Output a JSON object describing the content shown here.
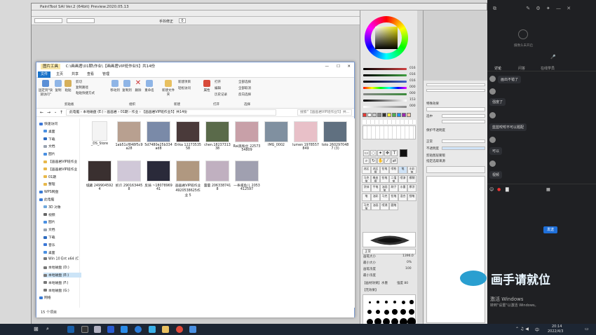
{
  "sai": {
    "title": "PaintTool SAI Ver.2 (64bit) Preview.2020.05.13",
    "menus": [
      "",
      "",
      "",
      "",
      "",
      "",
      "",
      "",
      ""
    ],
    "toolbar_zoom": "手抖修正",
    "toolbar_value": "0",
    "sliders": [
      {
        "value": "016",
        "color": "#d04040"
      },
      {
        "value": "016",
        "color": "#40a040"
      },
      {
        "value": "016",
        "color": "#4060d0"
      },
      {
        "value": "000",
        "color": "#c04040"
      },
      {
        "value": "000",
        "color": "#3a8a3a"
      },
      {
        "value": "153",
        "color": "#444444"
      },
      {
        "value": "000",
        "color": "#888888"
      }
    ],
    "layer_panel": {
      "section1": "特殊效果",
      "section2_a": "选中",
      "opacity_label": "不透明度",
      "opacity_value": "100%",
      "blend_label": "正常",
      "protect_label": "保护不透明度",
      "clip_label": "剪贴图层蒙版",
      "ref_label": "指定选取来源",
      "layer_name": "图层1",
      "layer_value": "100%",
      "status": "磁盘使用量",
      "status_value": "29%"
    },
    "brush_panel": {
      "brush_size_label": "画笔大小",
      "brush_size_value": "1396.0",
      "min_size_label": "最小大小",
      "min_size_value": "0%",
      "density_label": "画笔浓度",
      "density_value": "100",
      "min_density_label": "最小浓度",
      "texture_label": "【画材效果】水墨",
      "texture_value": "强度 80",
      "shape_label": "【无效果】",
      "blend_mode": "正常",
      "memory_label": "内存使用量",
      "memory_value": "23% (29%)"
    },
    "brushes": [
      "选区",
      "选区擦",
      "铅笔",
      "喷枪",
      "笔",
      "水彩笔",
      "马克笔",
      "橡皮擦",
      "铅笔",
      "二值笔",
      "喷漆",
      "模糊",
      "涂抹",
      "平笔",
      "油画笔",
      "刷子",
      "水墨",
      "厚涂",
      "笔",
      "油彩",
      "马克",
      "铅笔",
      "混合",
      "细笔",
      "马克笔",
      "油画",
      "喷溅",
      "圆笔"
    ]
  },
  "explorer": {
    "title": "C:\\画画君\\01期\\作业\\【画画君VIP班作业5】共14份",
    "tab_active": "图片工具",
    "tabs": [
      "文件",
      "主页",
      "共享",
      "查看",
      "管理"
    ],
    "ribbon": {
      "pin": "固定到\"快速访问\"",
      "copy": "复制",
      "paste": "粘贴",
      "cut": "剪切",
      "copy_path": "复制路径",
      "paste_shortcut": "粘贴快捷方式",
      "group_clipboard": "剪贴板",
      "move_to": "移动到",
      "copy_to": "复制到",
      "delete": "删除",
      "rename": "重命名",
      "group_organize": "组织",
      "new_folder": "新建文件夹",
      "new_item": "新建项目",
      "easy_access": "轻松访问",
      "group_new": "新建",
      "properties": "属性",
      "open": "打开",
      "edit": "编辑",
      "history": "历史记录",
      "group_open": "打开",
      "select_all": "全部选择",
      "select_none": "全部取消",
      "invert": "反向选择",
      "group_select": "选择"
    },
    "breadcrumb": "此电脑 › 本地磁盘 (E:) › 画画君 › 01期 › 作业 › 【画画君VIP班作业5】共14份",
    "search_placeholder": "搜索\"【画画君VIP班作业5】共...",
    "sidebar": [
      {
        "label": "快速访问",
        "color": "#3c78d8"
      },
      {
        "label": "桌面",
        "color": "#4a90e2"
      },
      {
        "label": "下载",
        "color": "#2d6cc0"
      },
      {
        "label": "文档",
        "color": "#9aa4b1"
      },
      {
        "label": "图片",
        "color": "#4a90e2"
      },
      {
        "label": "【画画君VIP班作业",
        "color": "#e8b84a"
      },
      {
        "label": "【画画君VIP班作业",
        "color": "#e8b84a"
      },
      {
        "label": "01期",
        "color": "#e8b84a"
      },
      {
        "label": "整理",
        "color": "#e8b84a"
      },
      {
        "label": "WPS网盘",
        "color": "#3a7bd5"
      },
      {
        "label": "此电脑",
        "color": "#3a7bd5"
      },
      {
        "label": "3D 对象",
        "color": "#6fa8dc"
      },
      {
        "label": "视频",
        "color": "#666666"
      },
      {
        "label": "图片",
        "color": "#4a90e2"
      },
      {
        "label": "文档",
        "color": "#9aa4b1"
      },
      {
        "label": "下载",
        "color": "#2d6cc0"
      },
      {
        "label": "音乐",
        "color": "#3c78d8"
      },
      {
        "label": "桌面",
        "color": "#4a90e2"
      },
      {
        "label": "Win 10 Ent x64 (C",
        "color": "#777777"
      },
      {
        "label": "本地磁盘 (D:)",
        "color": "#777777"
      },
      {
        "label": "本地磁盘 (E:)",
        "color": "#777777"
      },
      {
        "label": "本地磁盘 (F:)",
        "color": "#777777"
      },
      {
        "label": "本地磁盘 (G:)",
        "color": "#777777"
      },
      {
        "label": "网络",
        "color": "#3a7bd5"
      }
    ],
    "files": [
      {
        "name": "_DS_Store",
        "color": "#f4f4f4"
      },
      {
        "name": "1ab51cf848f5c9a28",
        "color": "#b8a090"
      },
      {
        "name": "5d7480e25b334ad8",
        "color": "#7a8aa8"
      },
      {
        "name": "Erika 1227353558",
        "color": "#4a3a3a"
      },
      {
        "name": "chen.1823731338",
        "color": "#5a6a4a"
      },
      {
        "name": "Rai黑粉丝 2257354809",
        "color": "#c8a0a8"
      },
      {
        "name": "IMG_0002",
        "color": "#8090a0"
      },
      {
        "name": "lumen 1978557849",
        "color": "#e8c0c8"
      },
      {
        "name": "toto 2602970487 (3)",
        "color": "#607080"
      },
      {
        "name": "城藏 2499045924",
        "color": "#3a3030"
      },
      {
        "name": "抓爪 2901634458",
        "color": "#d0c8d8"
      },
      {
        "name": "反骑 ~1807896941",
        "color": "#2a2a3a"
      },
      {
        "name": "画画君VIP班作业 4920538625作业 5",
        "color": "#b09880"
      },
      {
        "name": "蕾蕾 2063387418",
        "color": "#c0b0c0"
      },
      {
        "name": "一条咸鱼儿 2053412597",
        "color": "#a0a0b0"
      }
    ],
    "status": "15 个项目"
  },
  "chat": {
    "cam_label": "摄像头未开启",
    "tabs": [
      "讨论",
      "问答",
      "在线学员"
    ],
    "messages": [
      "画出不错了",
      "强度了",
      "稍有特殊",
      "蓝蓝咬咬不可以题配",
      "可以",
      "视频"
    ],
    "send": "发送",
    "watermark": "画手请就位",
    "activate": "激活 Windows",
    "activate_sub": "转到\"设置\"以激活 Windows。"
  },
  "taskbar": {
    "time": "20:14",
    "date": "2022/4/3",
    "lang": "中"
  }
}
